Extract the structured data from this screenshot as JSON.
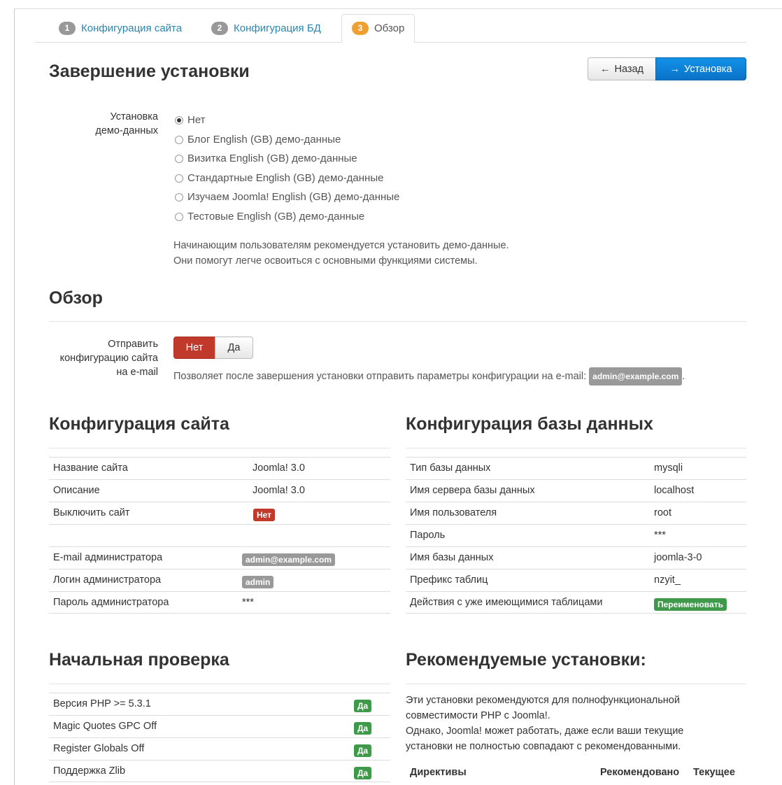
{
  "tabs": [
    {
      "num": "1",
      "label": "Конфигурация сайта"
    },
    {
      "num": "2",
      "label": "Конфигурация БД"
    },
    {
      "num": "3",
      "label": "Обзор"
    }
  ],
  "header": {
    "title": "Завершение установки",
    "back_label": "Назад",
    "install_label": "Установка"
  },
  "demo": {
    "label_line1": "Установка",
    "label_line2": "демо-данных",
    "options": [
      "Нет",
      "Блог English (GB) демо-данные",
      "Визитка English (GB) демо-данные",
      "Стандартные English (GB) демо-данные",
      "Изучаем Joomla! English (GB) демо-данные",
      "Тестовые English (GB) демо-данные"
    ],
    "selected": "Нет",
    "help_line1": "Начинающим пользователям рекомендуется установить демо-данные.",
    "help_line2": "Они помогут легче освоиться с основными функциями системы."
  },
  "overview": {
    "title": "Обзор",
    "email_label_1": "Отправить",
    "email_label_2": "конфигурацию сайта",
    "email_label_3": "на e-mail",
    "toggle_no": "Нет",
    "toggle_yes": "Да",
    "email_help": "Позволяет после завершения установки отправить параметры конфигурации на e-mail:",
    "email_value": "admin@example.com"
  },
  "site_config": {
    "title": "Конфигурация сайта",
    "rows": [
      {
        "key": "Название сайта",
        "value": "Joomla! 3.0"
      },
      {
        "key": "Описание",
        "value": "Joomla! 3.0"
      },
      {
        "key": "Выключить сайт",
        "value": "Нет"
      },
      {
        "key": "",
        "value": ""
      },
      {
        "key": "E-mail администратора",
        "value": "admin@example.com"
      },
      {
        "key": "Логин администратора",
        "value": "admin"
      },
      {
        "key": "Пароль администратора",
        "value": "***"
      }
    ]
  },
  "db_config": {
    "title": "Конфигурация базы данных",
    "rows": [
      {
        "key": "Тип базы данных",
        "value": "mysqli"
      },
      {
        "key": "Имя сервера базы данных",
        "value": "localhost"
      },
      {
        "key": "Имя пользователя",
        "value": "root"
      },
      {
        "key": "Пароль",
        "value": "***"
      },
      {
        "key": "Имя базы данных",
        "value": "joomla-3-0"
      },
      {
        "key": "Префикс таблиц",
        "value": "nzyit_"
      },
      {
        "key": "Действия с уже имеющимися таблицами",
        "value": "Переименовать"
      }
    ]
  },
  "precheck": {
    "title": "Начальная проверка",
    "rows": [
      {
        "key": "Версия PHP >= 5.3.1",
        "value": "Да"
      },
      {
        "key": "Magic Quotes GPC Off",
        "value": "Да"
      },
      {
        "key": "Register Globals Off",
        "value": "Да"
      },
      {
        "key": "Поддержка Zlib",
        "value": "Да"
      }
    ]
  },
  "recommended": {
    "title": "Рекомендуемые установки:",
    "text_1": "Эти установки рекомендуются для полнофункциональной",
    "text_2": "совместимости PHP с Joomla!.",
    "text_3": "Однако, Joomla! может работать, даже если ваши текущие",
    "text_4": "установки не полностью совпадают с рекомендованными.",
    "col_directive": "Директивы",
    "col_recommended": "Рекомендовано",
    "col_current": "Текущее"
  }
}
